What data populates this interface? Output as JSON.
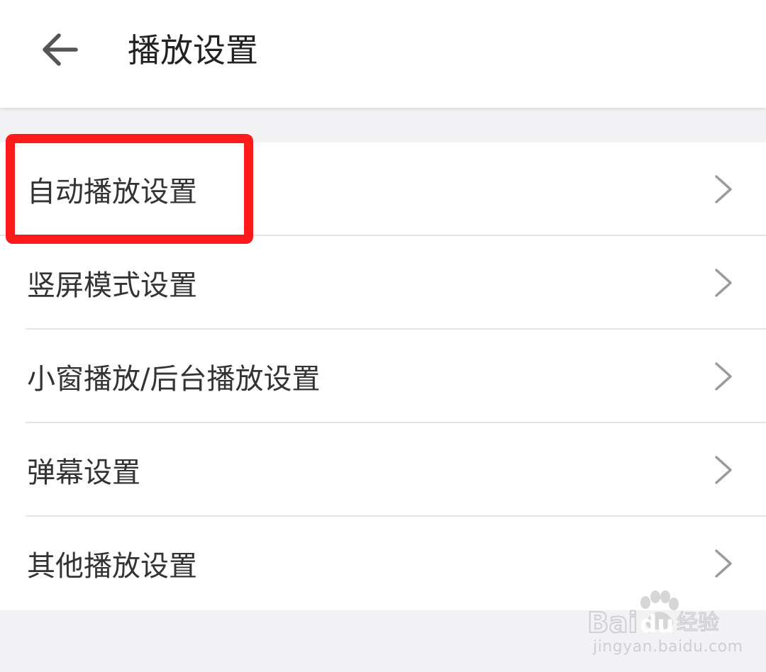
{
  "header": {
    "title": "播放设置",
    "back_icon": "arrow-left-icon"
  },
  "settings": {
    "items": [
      {
        "label": "自动播放设置",
        "highlighted": true
      },
      {
        "label": "竖屏模式设置"
      },
      {
        "label": "小窗播放/后台播放设置"
      },
      {
        "label": "弹幕设置"
      },
      {
        "label": "其他播放设置"
      }
    ],
    "chevron_icon": "chevron-right-icon"
  },
  "annotation": {
    "color": "#ff1a1a"
  },
  "watermark": {
    "logo_text": "Bai du 经验",
    "url": "jingyan.baidu.com"
  },
  "colors": {
    "background": "#f2f2f4",
    "surface": "#ffffff",
    "divider": "#e4e4e6",
    "chevron": "#9a9a9a"
  }
}
